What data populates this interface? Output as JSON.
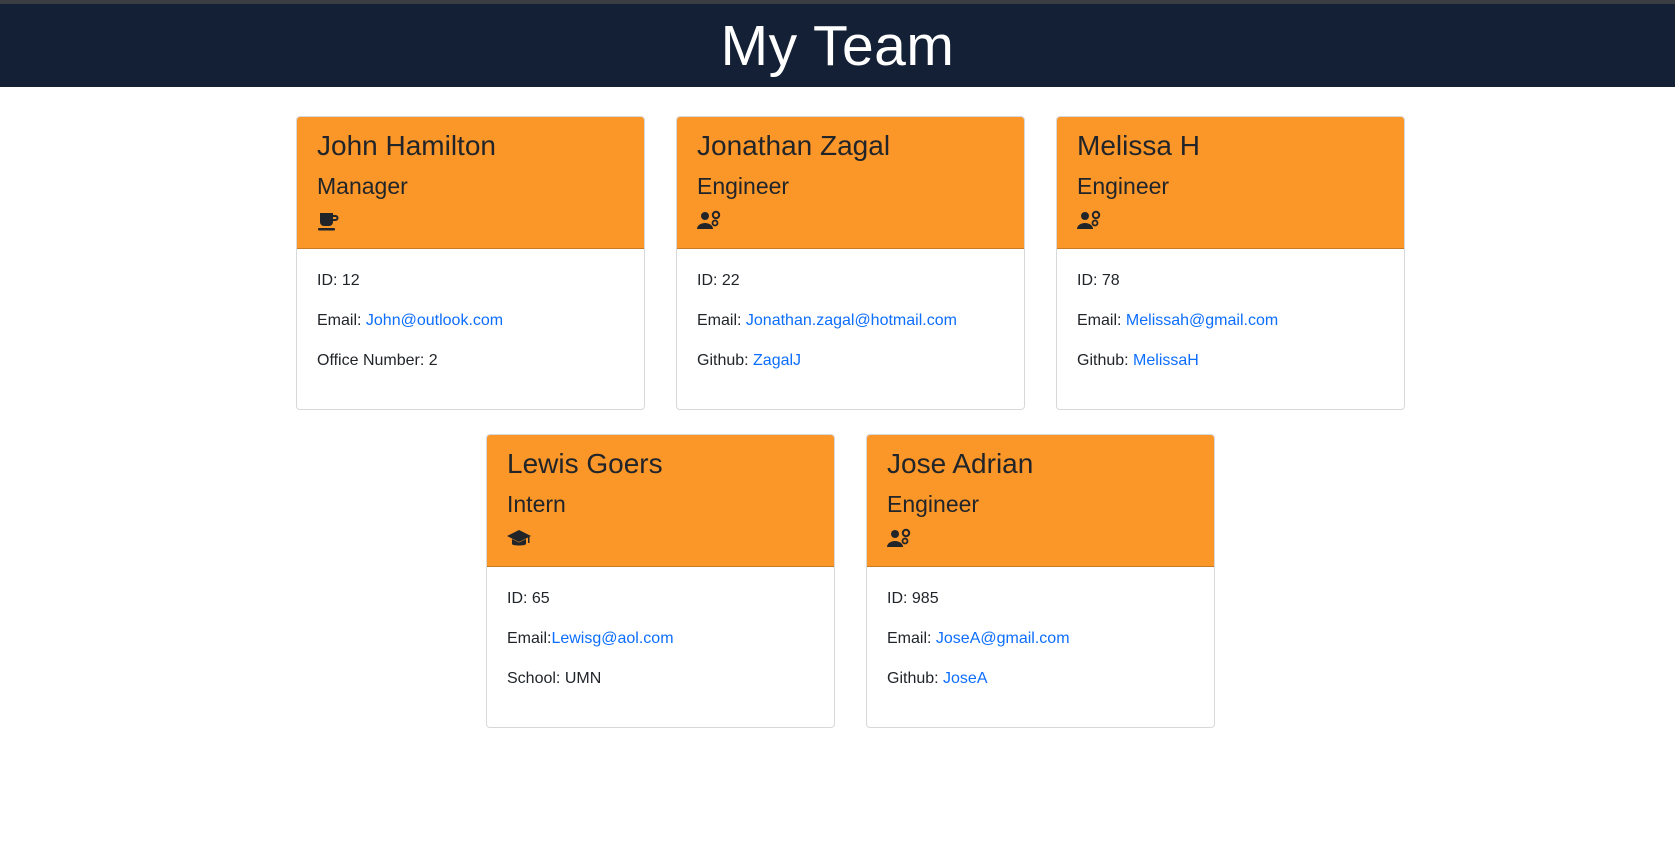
{
  "page": {
    "title": "My Team"
  },
  "cards": [
    {
      "name": "John Hamilton",
      "role": "Manager",
      "icon": "coffee-mug-icon",
      "id_label": "ID: 12",
      "email_label": "Email: ",
      "email": "John@outlook.com",
      "extra_label": "Office Number: 2",
      "extra_link": ""
    },
    {
      "name": "Jonathan Zagal",
      "role": "Engineer",
      "icon": "user-gear-icon",
      "id_label": "ID: 22",
      "email_label": "Email: ",
      "email": "Jonathan.zagal@hotmail.com",
      "extra_label": "Github: ",
      "extra_link": "ZagalJ"
    },
    {
      "name": "Melissa H",
      "role": "Engineer",
      "icon": "user-gear-icon",
      "id_label": "ID: 78",
      "email_label": "Email: ",
      "email": "Melissah@gmail.com",
      "extra_label": "Github: ",
      "extra_link": "MelissaH"
    },
    {
      "name": "Lewis Goers",
      "role": "Intern",
      "icon": "graduation-cap-icon",
      "id_label": "ID: 65",
      "email_label": "Email:",
      "email": "Lewisg@aol.com",
      "extra_label": "School: UMN",
      "extra_link": ""
    },
    {
      "name": "Jose Adrian",
      "role": "Engineer",
      "icon": "user-gear-icon",
      "id_label": "ID: 985",
      "email_label": "Email: ",
      "email": "JoseA@gmail.com",
      "extra_label": "Github: ",
      "extra_link": "JoseA"
    }
  ],
  "colors": {
    "header_bg": "#142036",
    "card_head_bg": "#fb9629",
    "link": "#0d6efd"
  }
}
